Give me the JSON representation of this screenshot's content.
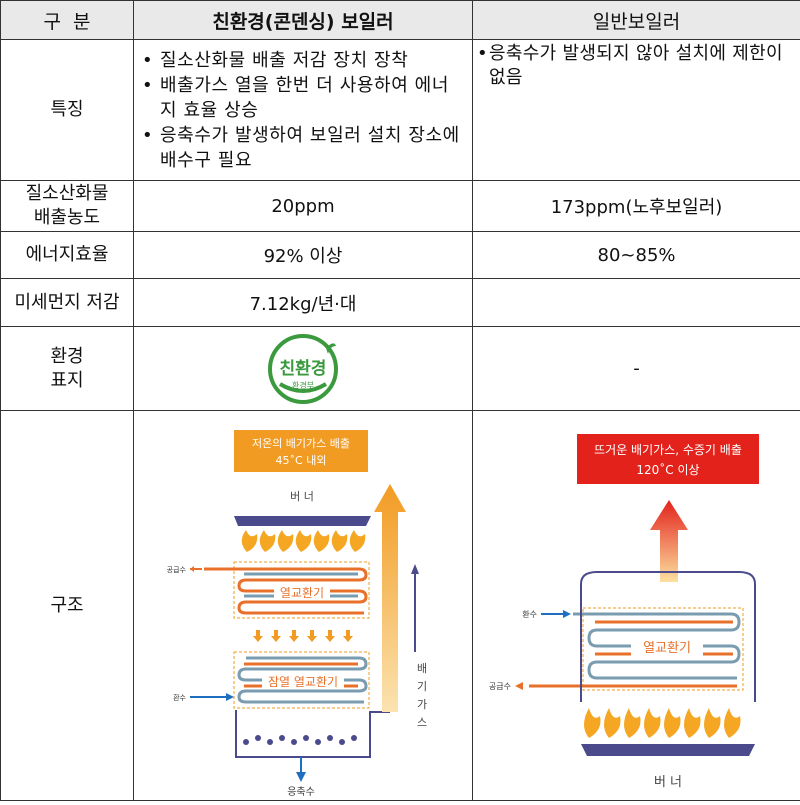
{
  "header": {
    "col1": "구  분",
    "col2": "친환경(콘덴싱) 보일러",
    "col3": "일반보일러"
  },
  "rows": {
    "feature": {
      "label": "특징",
      "condensing": [
        "질소산화물 배출 저감 장치 장착",
        "배출가스 열을 한번 더 사용하여 에너지 효율 상승",
        "응축수가 발생하여 보일러 설치 장소에 배수구 필요"
      ],
      "general": "응축수가 발생되지 않아 설치에 제한이 없음"
    },
    "nox": {
      "label_1": "질소산화물",
      "label_2": "배출농도",
      "condensing": "20ppm",
      "general": "173ppm(노후보일러)"
    },
    "efficiency": {
      "label": "에너지효율",
      "condensing": "92% 이상",
      "general": "80~85%"
    },
    "dust": {
      "label": "미세먼지 저감",
      "condensing": "7.12kg/년·대",
      "general": ""
    },
    "eco": {
      "label_1": "환경",
      "label_2": "표지",
      "logo_main": "친환경",
      "logo_sub": "환경부",
      "general": "-"
    },
    "structure": {
      "label": "구조",
      "condensing_diagram": {
        "top_box": "저온의 배기가스 배출",
        "top_box_temp": "45˚C 내외",
        "burner": "버 너",
        "supply": "공급수",
        "return": "환수",
        "heat_exchanger": "열교환기",
        "latent_exchanger": "잠열 열교환기",
        "exhaust_vertical": [
          "배",
          "기",
          "가",
          "스"
        ],
        "condensate": "응축수"
      },
      "general_diagram": {
        "top_box": "뜨거운 배기가스, 수증기 배출",
        "top_box_temp": "120˚C 이상",
        "return": "환수",
        "supply": "공급수",
        "heat_exchanger": "열교환기",
        "burner": "버 너"
      }
    }
  },
  "colors": {
    "header_bg": "#e9e9e9",
    "orange": "#f29b22",
    "red": "#e3221b",
    "navy": "#4a4a8c",
    "logo_green": "#3a9a3d"
  }
}
